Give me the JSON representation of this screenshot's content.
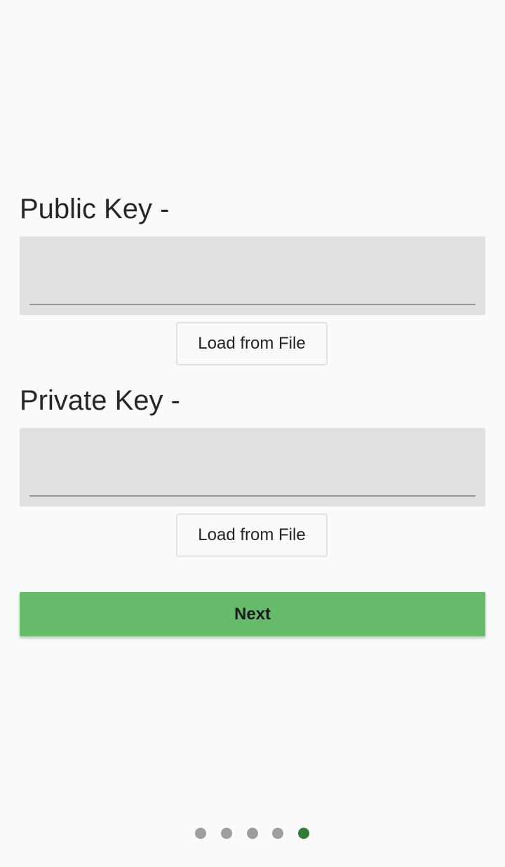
{
  "public_key": {
    "label": "Public Key -",
    "value": "",
    "load_button_label": "Load from File"
  },
  "private_key": {
    "label": "Private Key -",
    "value": "",
    "load_button_label": "Load from File"
  },
  "next_button_label": "Next",
  "pager": {
    "total_pages": 5,
    "current_page": 5,
    "active_color": "#2e7d32",
    "inactive_color": "#9e9e9e"
  },
  "colors": {
    "accent": "#66bb6a",
    "background": "#fafafa",
    "field_background": "#e1e1e1"
  }
}
